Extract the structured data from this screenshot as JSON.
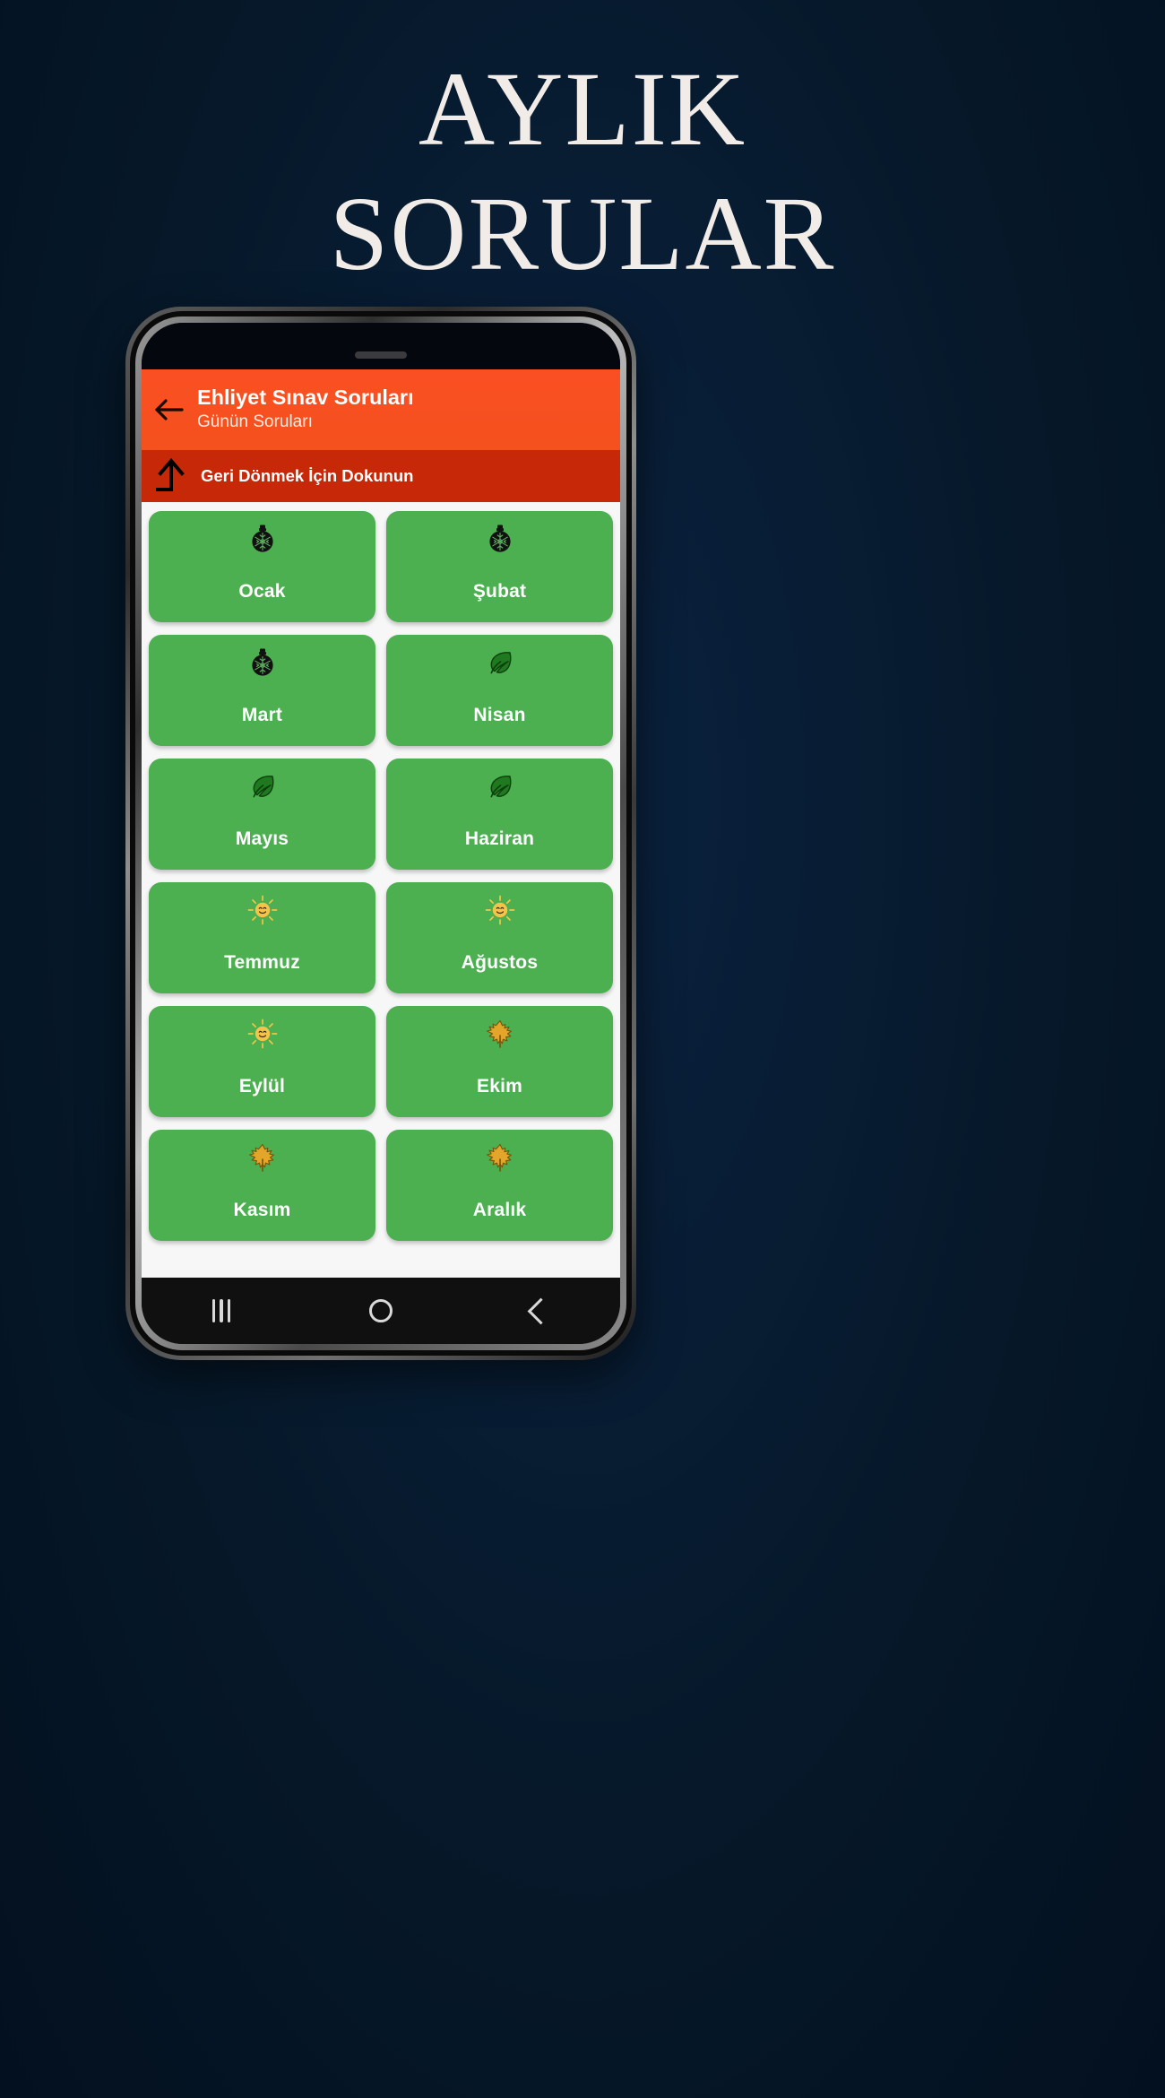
{
  "poster": {
    "title_line1": "AYLIK",
    "title_line2": "SORULAR",
    "background_color": "#06182e",
    "title_color": "#f2ece8"
  },
  "app": {
    "header": {
      "back_icon": "arrow-left-icon",
      "title": "Ehliyet Sınav Soruları",
      "subtitle": "Günün Soruları",
      "background_color": "#f4511e",
      "title_color": "#ffffff"
    },
    "hint_bar": {
      "icon": "arrow-up-icon",
      "text": "Geri Dönmek İçin Dokunun",
      "background_color": "#c62808",
      "text_color": "#ffffff"
    },
    "months": [
      {
        "label": "Ocak",
        "icon": "christmas-ornament-icon"
      },
      {
        "label": "Şubat",
        "icon": "christmas-ornament-icon"
      },
      {
        "label": "Mart",
        "icon": "christmas-ornament-icon"
      },
      {
        "label": "Nisan",
        "icon": "leaf-icon"
      },
      {
        "label": "Mayıs",
        "icon": "leaf-icon"
      },
      {
        "label": "Haziran",
        "icon": "leaf-icon"
      },
      {
        "label": "Temmuz",
        "icon": "sun-smiling-icon"
      },
      {
        "label": "Ağustos",
        "icon": "sun-smiling-icon"
      },
      {
        "label": "Eylül",
        "icon": "sun-smiling-icon"
      },
      {
        "label": "Ekim",
        "icon": "maple-leaf-icon"
      },
      {
        "label": "Kasım",
        "icon": "maple-leaf-icon"
      },
      {
        "label": "Aralık",
        "icon": "maple-leaf-icon"
      }
    ],
    "month_card_color": "#4caf50",
    "month_label_color": "#ffffff",
    "content_background": "#f7f7f7",
    "navbar": {
      "recents_icon": "recents-icon",
      "home_icon": "home-circle-icon",
      "back_icon": "back-chevron-icon"
    }
  }
}
